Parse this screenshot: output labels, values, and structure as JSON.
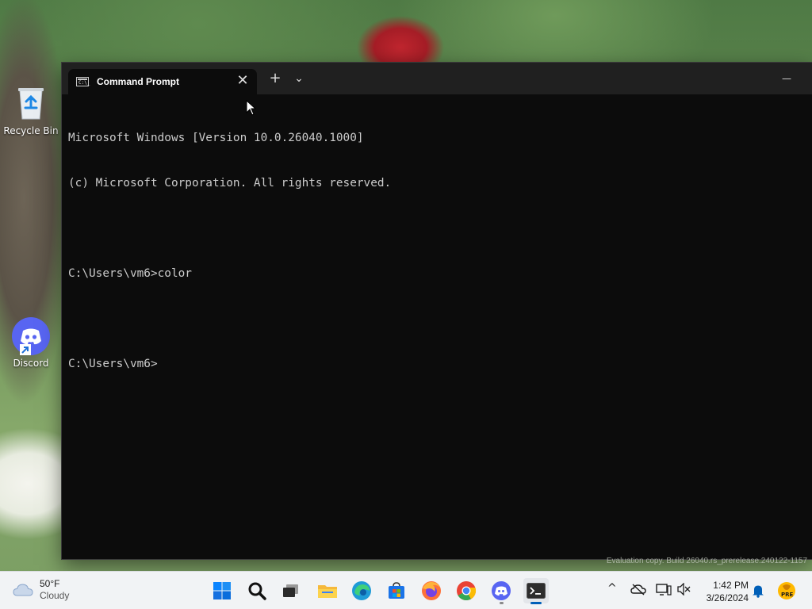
{
  "desktop": {
    "icons": [
      {
        "label": "Recycle Bin",
        "icon": "recycle-bin-icon"
      },
      {
        "label": "Discord",
        "icon": "discord-icon"
      }
    ],
    "watermark": "Evaluation copy. Build 26040.rs_prerelease.240122-1157"
  },
  "window": {
    "tab_title": "Command Prompt",
    "tab_icon": "cmd-icon",
    "tab_icon_text": "C:\\_",
    "close_tab_symbol": "✕",
    "new_tab_symbol": "+",
    "dropdown_symbol": "⌄",
    "minimize_symbol": "—",
    "console_lines": [
      "Microsoft Windows [Version 10.0.26040.1000]",
      "(c) Microsoft Corporation. All rights reserved.",
      "",
      "C:\\Users\\vm6>color",
      "",
      "C:\\Users\\vm6>"
    ]
  },
  "taskbar": {
    "weather": {
      "temp": "50°F",
      "condition": "Cloudy",
      "icon": "cloud-icon"
    },
    "apps": [
      {
        "name": "start",
        "icon": "windows-icon"
      },
      {
        "name": "search",
        "icon": "search-icon"
      },
      {
        "name": "task-view",
        "icon": "task-view-icon"
      },
      {
        "name": "file-explorer",
        "icon": "folder-icon"
      },
      {
        "name": "edge",
        "icon": "edge-icon"
      },
      {
        "name": "store",
        "icon": "store-icon"
      },
      {
        "name": "firefox",
        "icon": "firefox-icon"
      },
      {
        "name": "chrome",
        "icon": "chrome-icon"
      },
      {
        "name": "discord",
        "icon": "discord-icon"
      },
      {
        "name": "terminal",
        "icon": "terminal-icon"
      }
    ],
    "tray": {
      "chevron": "^",
      "clock_time": "1:42 PM",
      "clock_date": "3/26/2024",
      "badge_text": "PRE"
    }
  },
  "colors": {
    "terminal_bg": "#0c0c0c",
    "terminal_fg": "#cccccc",
    "titlebar_bg": "#202020",
    "taskbar_bg": "#f1f3f5",
    "accent": "#005fb8"
  }
}
